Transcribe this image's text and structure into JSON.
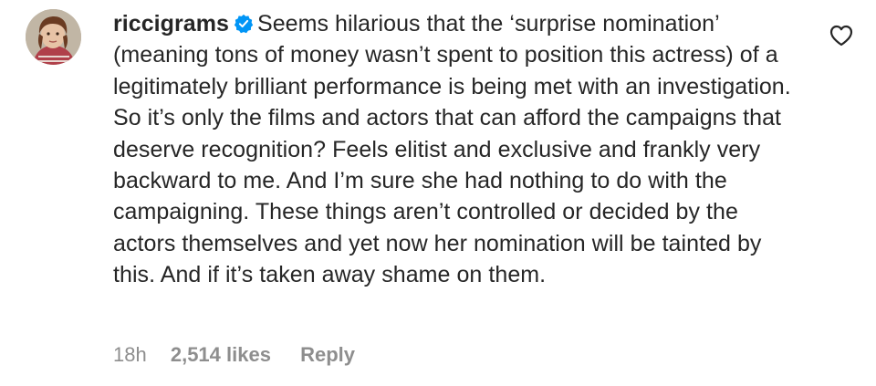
{
  "comment": {
    "username": "riccigrams",
    "verified_icon": "verified-badge-icon",
    "text": "Seems hilarious that the ‘surprise nomination’ (meaning tons of money wasn’t spent to position this actress) of a legitimately brilliant performance is being met with an investigation. So it’s only the films and actors that can afford the campaigns that deserve recognition? Feels elitist and exclusive and frankly very backward to me. And I’m sure she had nothing to do with the campaigning. These things aren’t controlled or decided by the actors themselves and yet now her nomination will be tainted by this. And if it’s taken away shame on them.",
    "like_icon": "heart-outline-icon",
    "meta": {
      "time": "18h",
      "likes": "2,514 likes",
      "reply_label": "Reply"
    }
  },
  "colors": {
    "text": "#262626",
    "secondary": "#8e8e8e",
    "verified": "#0095f6"
  }
}
